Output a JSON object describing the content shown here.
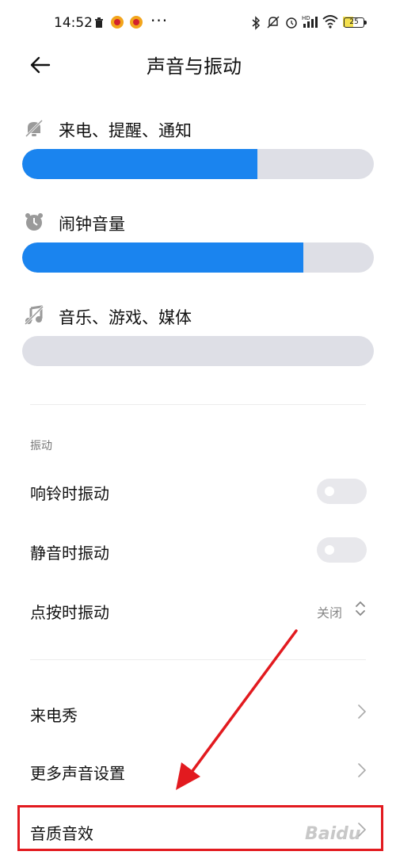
{
  "status_bar": {
    "time": "14:52",
    "battery": "25",
    "more": "···",
    "bluetooth_icon": "bluetooth-icon"
  },
  "header": {
    "title": "声音与振动",
    "back_icon": "back-arrow-icon"
  },
  "volume": [
    {
      "label": "来电、提醒、通知",
      "icon": "bell-muted-icon",
      "level": 0.67
    },
    {
      "label": "闹钟音量",
      "icon": "alarm-clock-icon",
      "level": 0.8
    },
    {
      "label": "音乐、游戏、媒体",
      "icon": "music-muted-icon",
      "level": 0.0
    }
  ],
  "vibration": {
    "section_title": "振动",
    "ring_vibrate": {
      "label": "响铃时振动",
      "on": false
    },
    "silent_vibrate": {
      "label": "静音时振动",
      "on": false
    },
    "tap_vibrate": {
      "label": "点按时振动",
      "value": "关闭"
    }
  },
  "menu": [
    {
      "label": "来电秀"
    },
    {
      "label": "更多声音设置"
    },
    {
      "label": "音质音效"
    }
  ],
  "colors": {
    "accent": "#1a84ef",
    "track": "#dedfe6",
    "annotation": "#e21a1f"
  },
  "watermark": "Baidu"
}
